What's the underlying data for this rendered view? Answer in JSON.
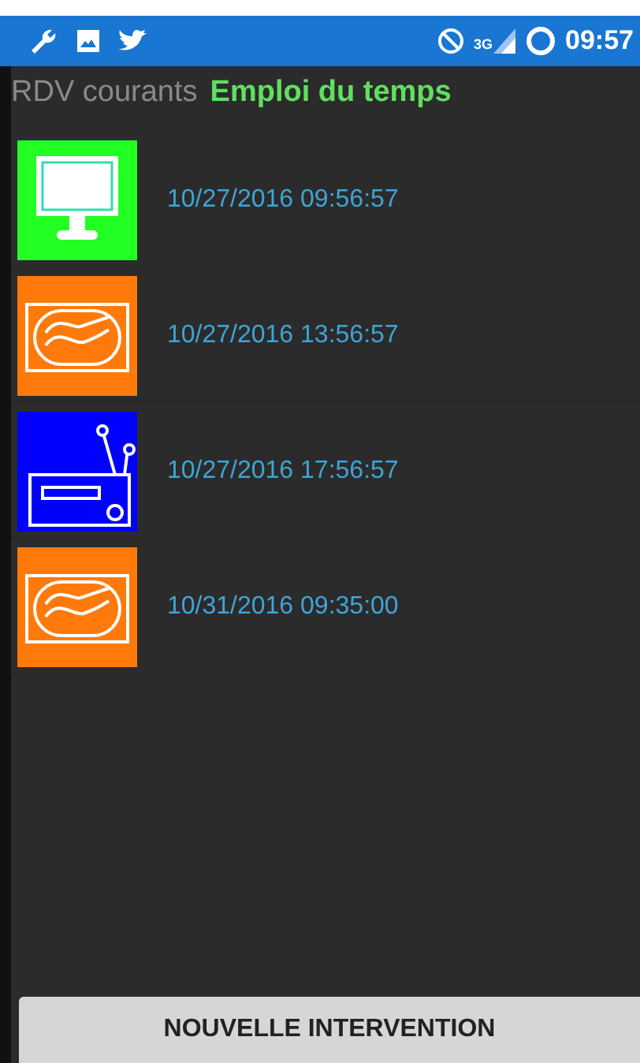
{
  "status_bar": {
    "time": "09:57",
    "network": "3G"
  },
  "tabs": [
    {
      "label": "RDV courants",
      "selected": false
    },
    {
      "label": "Emploi du temps",
      "selected": true
    }
  ],
  "appointments": [
    {
      "kind": "monitor",
      "color": "#22ff22",
      "datetime": "10/27/2016 09:56:57"
    },
    {
      "kind": "wave",
      "color": "#ff7a0a",
      "datetime": "10/27/2016 13:56:57"
    },
    {
      "kind": "radio",
      "color": "#0000ff",
      "datetime": "10/27/2016 17:56:57"
    },
    {
      "kind": "wave",
      "color": "#ff7a0a",
      "datetime": "10/31/2016 09:35:00"
    }
  ],
  "button": "NOUVELLE INTERVENTION"
}
